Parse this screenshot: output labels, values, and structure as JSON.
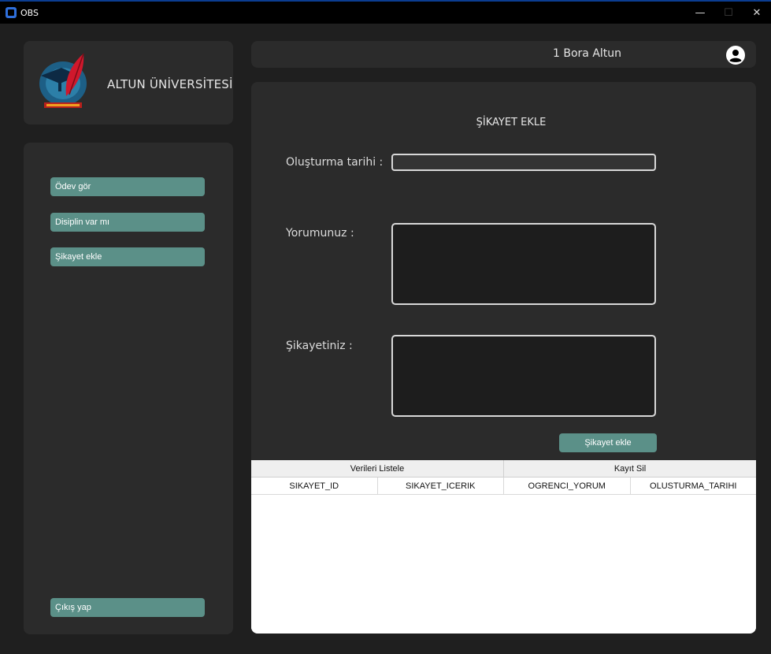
{
  "window": {
    "title": "OBS",
    "controls": {
      "minimize": "—",
      "maximize": "☐",
      "close": "✕"
    }
  },
  "brand": {
    "university_name": "ALTUN ÜNİVERSİTESİ",
    "logo_icon": "university-logo-icon"
  },
  "sidebar": {
    "items": [
      {
        "label": "Ödev gör"
      },
      {
        "label": "Disiplin var mı"
      },
      {
        "label": "Şikayet ekle"
      }
    ],
    "logout_label": "Çıkış yap"
  },
  "header": {
    "user_label": "1  Bora Altun",
    "user_icon": "user-account-icon"
  },
  "form": {
    "title": "ŞİKAYET EKLE",
    "date_label": "Oluşturma tarihi :",
    "date_value": "",
    "comment_label": "Yorumunuz :",
    "comment_value": "",
    "complaint_label": "Şikayetiniz :",
    "complaint_value": "",
    "submit_label": "Şikayet ekle"
  },
  "table": {
    "tabs": [
      {
        "label": "Verileri Listele"
      },
      {
        "label": "Kayıt Sil"
      }
    ],
    "columns": [
      "SIKAYET_ID",
      "SIKAYET_ICERIK",
      "OGRENCI_YORUM",
      "OLUSTURMA_TARIHI"
    ],
    "rows": []
  },
  "colors": {
    "accent": "#5b9088",
    "panel": "#2b2b2b",
    "background": "#1f1f1f"
  }
}
